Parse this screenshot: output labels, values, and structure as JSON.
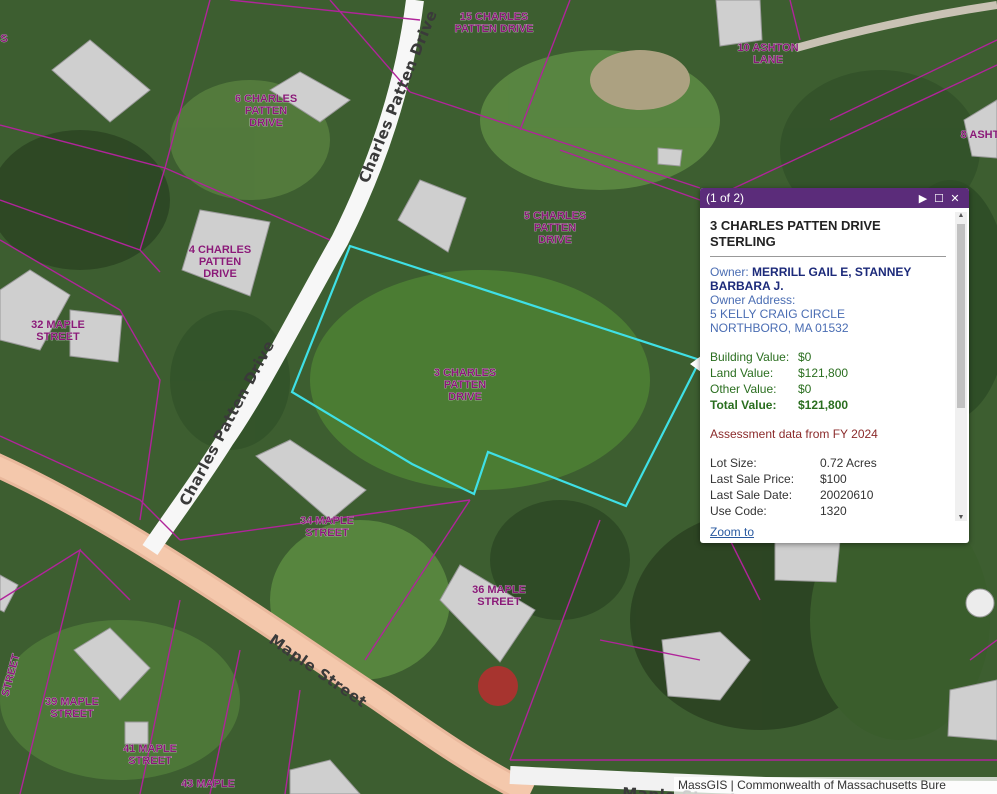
{
  "map": {
    "parcel_labels": [
      {
        "id": "15-charles",
        "lines": [
          "15 CHARLES",
          "PATTEN DRIVE"
        ]
      },
      {
        "id": "10-ashton",
        "lines": [
          "10 ASHTON",
          "LANE"
        ]
      },
      {
        "id": "6-charles",
        "lines": [
          "6 CHARLES",
          "PATTEN",
          "DRIVE"
        ]
      },
      {
        "id": "8-ashton",
        "lines": [
          "8 ASHT"
        ]
      },
      {
        "id": "5-charles",
        "lines": [
          "5 CHARLES",
          "PATTEN",
          "DRIVE"
        ]
      },
      {
        "id": "4-charles",
        "lines": [
          "4 CHARLES",
          "PATTEN",
          "DRIVE"
        ]
      },
      {
        "id": "32-maple",
        "lines": [
          "32 MAPLE",
          "STREET"
        ]
      },
      {
        "id": "3-charles",
        "lines": [
          "3 CHARLES",
          "PATTEN",
          "DRIVE"
        ]
      },
      {
        "id": "34-maple",
        "lines": [
          "34 MAPLE",
          "STREET"
        ]
      },
      {
        "id": "36-maple",
        "lines": [
          "36 MAPLE",
          "STREET"
        ]
      },
      {
        "id": "39-maple",
        "lines": [
          "39 MAPLE",
          "STREET"
        ]
      },
      {
        "id": "41-maple",
        "lines": [
          "41 MAPLE",
          "STREET"
        ]
      },
      {
        "id": "43-maple",
        "lines": [
          "43 MAPLE",
          "STREET"
        ]
      },
      {
        "id": "left-edge",
        "lines": [
          "S"
        ]
      },
      {
        "id": "left-edge-2",
        "lines": [
          "STREET"
        ]
      }
    ],
    "road_labels": {
      "charles_upper": "Charles Patten Drive",
      "charles_lower": "Charles Patten Drive",
      "maple": "Maple  Street",
      "maple_bottom": "Maple Street"
    },
    "colors": {
      "parcel_line": "#b0249a",
      "selected_parcel": "#3fe0e6",
      "label": "#8a1a78",
      "popup_header": "#5b2c7a"
    }
  },
  "popup": {
    "count": "(1 of 2)",
    "controls": {
      "next": "▶",
      "maximize": "☐",
      "close": "✕"
    },
    "title_line1": "3 CHARLES PATTEN DRIVE",
    "title_line2": "STERLING",
    "owner_label": "Owner:",
    "owner_value": "MERRILL GAIL E, STANNEY BARBARA J.",
    "owner_address_label": "Owner Address:",
    "address_line1": "5 KELLY CRAIG CIRCLE",
    "address_line2": "NORTHBORO, MA 01532",
    "values": [
      {
        "label": "Building Value:",
        "value": "$0"
      },
      {
        "label": "Land Value:",
        "value": "$121,800"
      },
      {
        "label": "Other Value:",
        "value": "$0"
      },
      {
        "label": "Total Value:",
        "value": "$121,800"
      }
    ],
    "assessment_note": "Assessment data from FY 2024",
    "details": [
      {
        "label": "Lot Size:",
        "value": "0.72 Acres"
      },
      {
        "label": "Last Sale Price:",
        "value": "$100"
      },
      {
        "label": "Last Sale Date:",
        "value": "20020610"
      },
      {
        "label": "Use Code:",
        "value": "1320"
      }
    ],
    "zoom_link": "Zoom to"
  },
  "attribution": "MassGIS | Commonwealth of Massachusetts Bure"
}
